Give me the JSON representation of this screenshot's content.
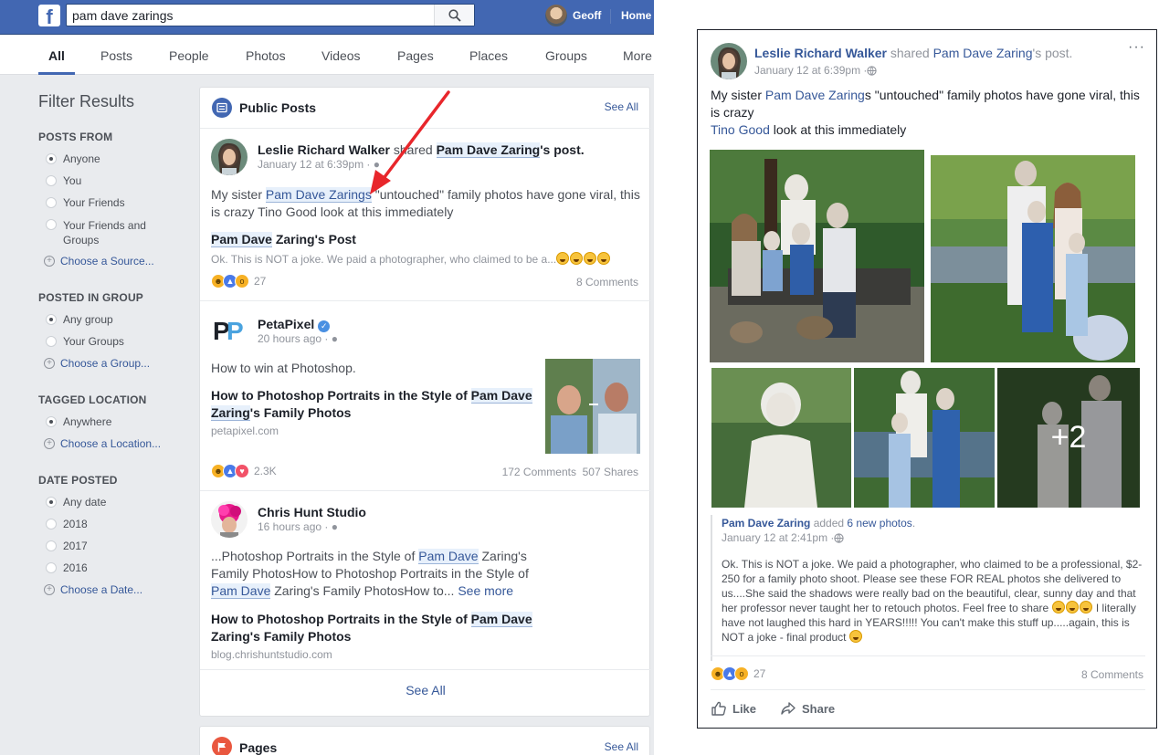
{
  "topbar": {
    "logo": "f",
    "search_value": "pam dave zarings",
    "user_name": "Geoff",
    "home_label": "Home"
  },
  "tabs": [
    "All",
    "Posts",
    "People",
    "Photos",
    "Videos",
    "Pages",
    "Places",
    "Groups",
    "More"
  ],
  "filters": {
    "title": "Filter Results",
    "posts_from": {
      "heading": "POSTS FROM",
      "options": [
        "Anyone",
        "You",
        "Your Friends",
        "Your Friends and Groups"
      ],
      "choose": "Choose a Source..."
    },
    "posted_in_group": {
      "heading": "POSTED IN GROUP",
      "options": [
        "Any group",
        "Your Groups"
      ],
      "choose": "Choose a Group..."
    },
    "tagged_location": {
      "heading": "TAGGED LOCATION",
      "options": [
        "Anywhere"
      ],
      "choose": "Choose a Location..."
    },
    "date_posted": {
      "heading": "DATE POSTED",
      "options": [
        "Any date",
        "2018",
        "2017",
        "2016"
      ],
      "choose": "Choose a Date..."
    }
  },
  "public_posts": {
    "title": "Public Posts",
    "see_all": "See All",
    "post1": {
      "author": "Leslie Richard Walker",
      "shared_text": " shared ",
      "shared_from": "Pam Dave Zaring",
      "shared_suffix": "'s post.",
      "meta": "January 12 at 6:39pm · ",
      "body_pre": "My sister ",
      "body_link": "Pam Dave Zarings",
      "body_post": " \"untouched\" family photos have gone viral, this is crazy Tino Good look at this immediately",
      "link_title_hl": "Pam Dave",
      "link_title_rest": " Zaring's Post",
      "snippet": "Ok. This is NOT a joke. We paid a photographer, who claimed to be a...",
      "reactions": "27",
      "comments": "8 Comments"
    },
    "post2": {
      "logo": "PP",
      "author": "PetaPixel",
      "meta": "20 hours ago · ",
      "body": "How to win at Photoshop.",
      "link_title_pre": "How to Photoshop Portraits in the Style of ",
      "link_title_hl1": "Pam Dave",
      "link_title_hl2": "Zaring",
      "link_title_post": "'s Family Photos",
      "domain": "petapixel.com",
      "reactions": "2.3K",
      "comments_shares": "172 Comments  507 Shares"
    },
    "post3": {
      "author": "Chris Hunt Studio",
      "meta": "16 hours ago · ",
      "body_1": "...Photoshop Portraits in the Style of ",
      "body_hl1": "Pam Dave",
      "body_2": " Zaring's Family PhotosHow to Photoshop Portraits in the Style of ",
      "body_hl2": "Pam Dave",
      "body_3": " Zaring's Family PhotosHow to... ",
      "see_more": "See more",
      "link_title_pre": "How to Photoshop Portraits in the Style of ",
      "link_title_hl": "Pam Dave",
      "link_title_post": " Zaring's Family Photos",
      "domain": "blog.chrishuntstudio.com"
    },
    "see_all_bottom": "See All"
  },
  "pages_section": {
    "title": "Pages",
    "see_all": "See All"
  },
  "expanded_post": {
    "author": "Leslie Richard Walker",
    "shared_text": " shared ",
    "shared_from": "Pam Dave Zaring",
    "shared_suffix": "'s post.",
    "meta": "January 12 at 6:39pm · ",
    "more": "···",
    "body_pre": "My sister ",
    "body_link": "Pam Dave Zaring",
    "body_post": "s \"untouched\" family photos have gone viral, this is crazy",
    "tag_name": "Tino Good",
    "tag_rest": " look at this immediately",
    "more_photos": "+2",
    "shared_author": "Pam Dave Zaring",
    "shared_added": " added ",
    "shared_new_photos": "6 new photos",
    "shared_period": ".",
    "shared_meta": "January 12 at 2:41pm · ",
    "shared_text_1": "Ok. This is NOT a joke. We paid a photographer, who claimed to be a professional, $2-250 for a family photo shoot. Please see these FOR REAL photos she delivered to us....She said the shadows were really bad on the beautiful, clear, sunny day and that her professor never taught her to retouch photos. Feel free to share ",
    "shared_text_2": " I literally have not laughed this hard in YEARS!!!!! You can't make this stuff up.....again, this is NOT a joke - final product ",
    "reactions": "27",
    "comments": "8 Comments",
    "like_label": "Like",
    "share_label": "Share"
  },
  "colors": {
    "fb_blue": "#4267b2",
    "link_blue": "#365899",
    "annotation_red": "#e8262b"
  }
}
